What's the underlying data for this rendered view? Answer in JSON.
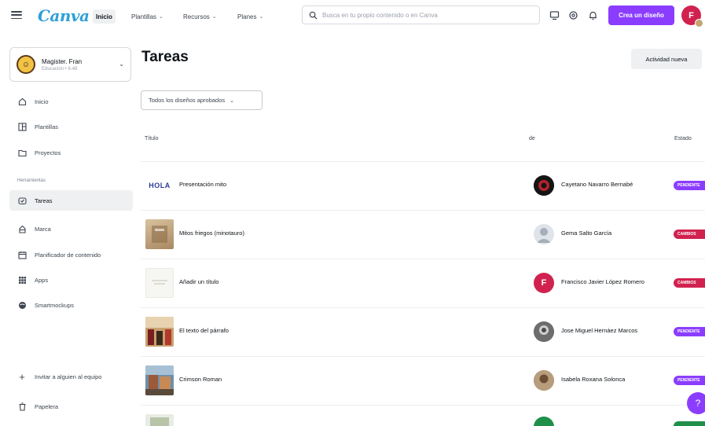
{
  "topbar": {
    "logo": "Canva",
    "nav": [
      {
        "label": "Inicio",
        "active": true
      },
      {
        "label": "Plantillas",
        "active": false
      },
      {
        "label": "Recursos",
        "active": false
      },
      {
        "label": "Planes",
        "active": false
      }
    ],
    "search_placeholder": "Busca en tu propio contenido o en Canva",
    "create_label": "Crea un diseño",
    "avatar_letter": "F",
    "colors": {
      "accent": "#8b3dff",
      "avatar": "#d1224f",
      "logo": "#2e9fd8"
    }
  },
  "sidebar": {
    "team_name": "Magister. Fran",
    "team_sub": "Educación • 6-48",
    "items": [
      {
        "label": "Inicio",
        "icon": "home-icon"
      },
      {
        "label": "Plantillas",
        "icon": "templates-icon"
      },
      {
        "label": "Proyectos",
        "icon": "folder-icon"
      }
    ],
    "tools_label": "Herramientas",
    "tools": [
      {
        "label": "Tareas",
        "icon": "tasks-icon",
        "active": true
      },
      {
        "label": "Marca",
        "icon": "brand-icon",
        "active": false
      },
      {
        "label": "Planificador de contenido",
        "icon": "calendar-icon",
        "active": false
      },
      {
        "label": "Apps",
        "icon": "apps-icon",
        "active": false
      },
      {
        "label": "Smartmockups",
        "icon": "smartmockups-icon",
        "active": false
      }
    ],
    "invite_label": "Invitar a alguien al equipo",
    "trash_label": "Papelera"
  },
  "main": {
    "title": "Tareas",
    "activity_button": "Actividad nueva",
    "filter_label": "Todos los diseños aprobados",
    "columns": {
      "title": "Título",
      "from": "de",
      "status": "Estado"
    },
    "rows": [
      {
        "title": "Presentación mito",
        "thumb_text": "HOLA",
        "person": "Cayetano Navarro Bernabé",
        "status": "PENDIENTE",
        "status_color": "#8b3dff"
      },
      {
        "title": "Mitos friegos (minotauro)",
        "thumb_text": "",
        "person": "Gema Salto García",
        "status": "CAMBIOS",
        "status_color": "#d1224f"
      },
      {
        "title": "Añadir un título",
        "thumb_text": "",
        "person": "Francisco Javier López Romero",
        "status": "CAMBIOS",
        "status_color": "#d1224f"
      },
      {
        "title": "El texto del párrafo",
        "thumb_text": "",
        "person": "Jose Miguel Hernáez Marcos",
        "status": "PENDIENTE",
        "status_color": "#8b3dff"
      },
      {
        "title": "Crimson Roman",
        "thumb_text": "",
        "person": "Isabela Roxana Solonca",
        "status": "PENDIENTE",
        "status_color": "#8b3dff"
      }
    ]
  },
  "help_label": "?"
}
